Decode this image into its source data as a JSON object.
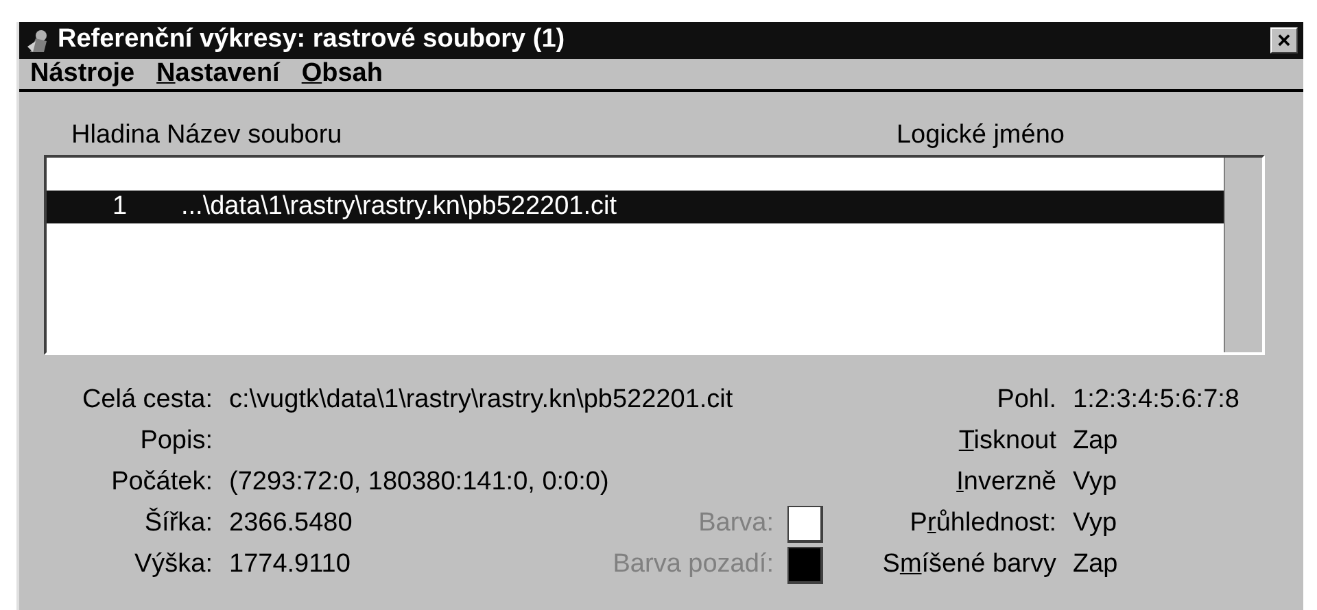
{
  "window": {
    "title": "Referenční výkresy: rastrové soubory (1)",
    "close": "×"
  },
  "menu": [
    {
      "pre": "Nástro",
      "accel": "j",
      "post": "e"
    },
    {
      "accel": "N",
      "post": "astavení"
    },
    {
      "accel": "O",
      "post": "bsah"
    }
  ],
  "list": {
    "columns": [
      "Hladina",
      "Název souboru",
      "Logické jméno"
    ],
    "rows": [
      {
        "layer": "1",
        "file": "...\\data\\1\\rastry\\rastry.kn\\pb522201.cit",
        "selected": true
      }
    ]
  },
  "details": [
    {
      "label": "Celá cesta:",
      "value": "c:\\vugtk\\data\\1\\rastry\\rastry.kn\\pb522201.cit"
    },
    {
      "label": "Popis:"
    },
    {
      "label": "Počátek:",
      "value": "(7293:72:0, 180380:141:0, 0:0:0)"
    },
    {
      "label": "Šířka:",
      "value": "2366.5480"
    },
    {
      "label": "Výška:",
      "value": "1774.9110"
    }
  ],
  "colors": [
    {
      "label": "Barva:",
      "color": "#ffffff",
      "disabled": true
    },
    {
      "label": "Barva pozadí:",
      "color": "#000000",
      "disabled": true
    }
  ],
  "options": [
    {
      "pre": "Pohl.",
      "value": "1:2:3:4:5:6:7:8"
    },
    {
      "accel": "T",
      "post": "isknout",
      "value": "Zap"
    },
    {
      "accel": "I",
      "post": "nverzně",
      "value": "Vyp"
    },
    {
      "pre": "P",
      "accel": "r",
      "post": "ůhlednost:",
      "value": "Vyp"
    },
    {
      "pre": "S",
      "accel": "m",
      "post": "íšené barvy",
      "value": "Zap"
    }
  ]
}
